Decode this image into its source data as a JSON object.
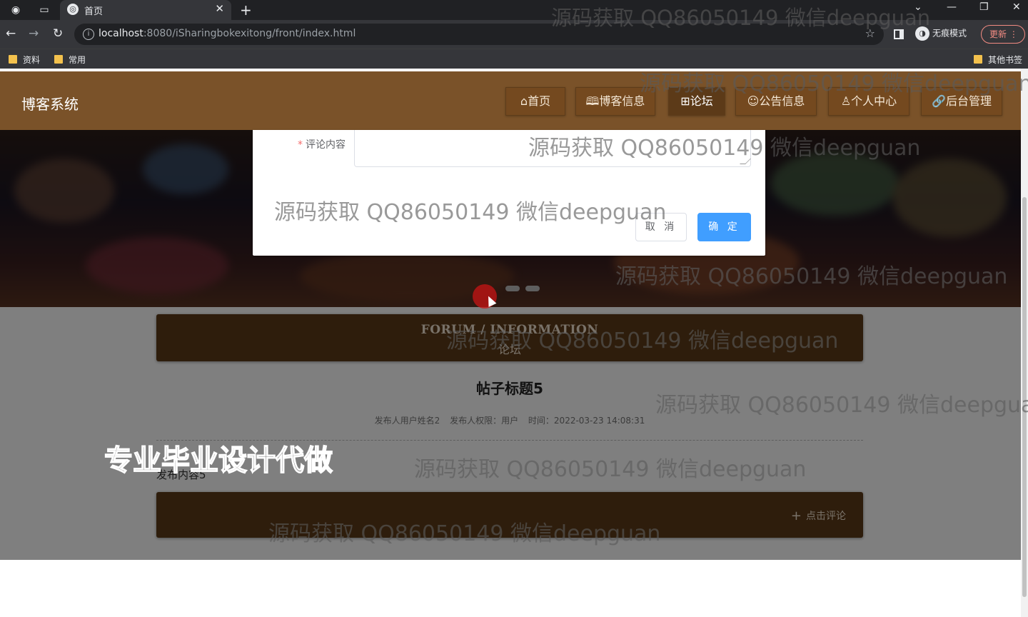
{
  "browser": {
    "tab_title": "首页",
    "url_host": "localhost",
    "url_rest": ":8080/iSharingbokexitong/front/index.html",
    "incognito_label": "无痕模式",
    "update_label": "更新",
    "bookmarks": [
      "资料",
      "常用"
    ],
    "other_bookmarks": "其他书签"
  },
  "site": {
    "logo": "博客系统",
    "nav": [
      {
        "icon": "⌂",
        "label": "首页"
      },
      {
        "icon": "🕮",
        "label": "博客信息"
      },
      {
        "icon": "⊞",
        "label": "论坛"
      },
      {
        "icon": "☺",
        "label": "公告信息"
      },
      {
        "icon": "♙",
        "label": "个人中心"
      },
      {
        "icon": "🔗",
        "label": "后台管理"
      }
    ]
  },
  "section": {
    "title_en": "FORUM / INFORMATION",
    "title_cn": "论坛"
  },
  "post": {
    "title": "帖子标题5",
    "meta_author": "发布人用户姓名2",
    "meta_role": "发布人权限：用户",
    "meta_time": "时间：2022-03-23 14:08:31",
    "body": "发布内容5",
    "comment_button": "点击评论"
  },
  "dialog": {
    "label": "评论内容",
    "cancel": "取 消",
    "confirm": "确 定"
  },
  "watermark": "源码获取 QQ86050149 微信deepguan",
  "promo": "专业毕业设计代做",
  "colors": {
    "header": "#7a5229",
    "accent_dark": "#5c3a18",
    "primary_button": "#409eff"
  }
}
